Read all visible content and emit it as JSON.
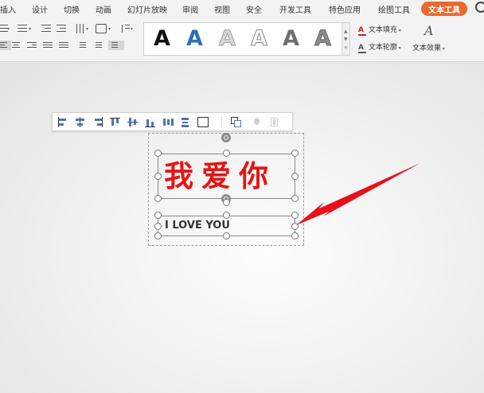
{
  "menu": {
    "tabs": [
      "插入",
      "设计",
      "切换",
      "动画",
      "幻灯片放映",
      "审阅",
      "视图",
      "安全",
      "开发工具",
      "特色应用",
      "绘图工具",
      "文本工具"
    ],
    "active_tab": "文本工具"
  },
  "ribbon": {
    "art_letter": "A",
    "text_fill_label": "文本填充",
    "text_outline_label": "文本轮廓",
    "text_effect_label": "文本效果",
    "text_effect_icon": "A",
    "fill_icon": "A",
    "outline_icon": "A"
  },
  "slide": {
    "chinese_text": "我爱你",
    "english_text": "I LOVE YOU"
  },
  "colors": {
    "accent": "#e86a30",
    "text_red": "#e51515",
    "arrow_red": "#e8101a"
  }
}
